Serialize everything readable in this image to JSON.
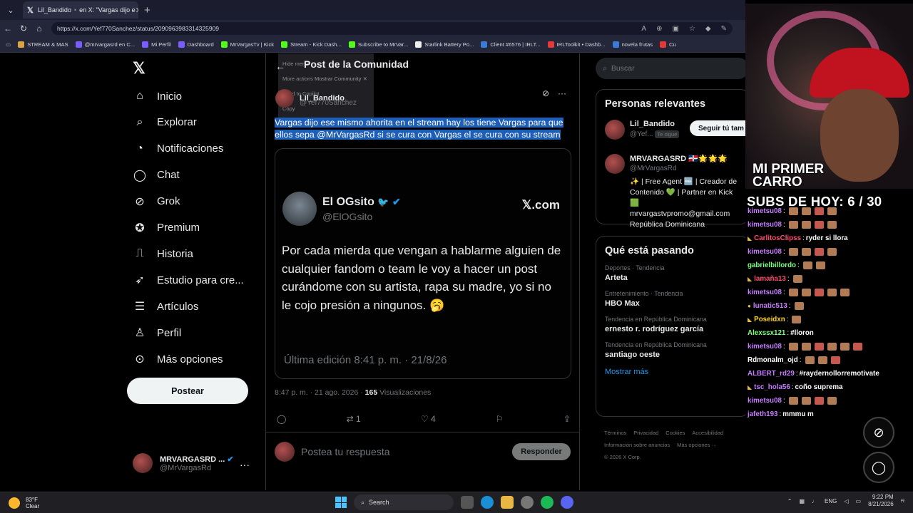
{
  "browser": {
    "tab_title": "Lil_Bandido",
    "tab_subtitle": "en X: \"Vargas dijo e",
    "url": "https://x.com/Yef770Sanchez/status/2090963983314325909",
    "bookmarks": [
      "STREAM & MAS",
      "@mrvargasrd en C...",
      "Mi Perfil",
      "Dashboard",
      "MrVargasTv | Kick",
      "Stream - Kick Dash...",
      "Subscribe to MrVar...",
      "Starlink Battery Po...",
      "Client #6576 | IRLT...",
      "IRLToolkit • Dashb...",
      "novela frutas",
      "Cu"
    ],
    "bookmark_colors": [
      "#d9a441",
      "#7b5cff",
      "#7b5cff",
      "#7b5cff",
      "#53fc18",
      "#53fc18",
      "#53fc18",
      "#eeeeee",
      "#3a7bd5",
      "#e53935",
      "#3a7bd5",
      "#e53935"
    ]
  },
  "nav": {
    "items": [
      {
        "label": "Inicio",
        "icon": "⌂",
        "name": "home"
      },
      {
        "label": "Explorar",
        "icon": "⌕",
        "name": "explore"
      },
      {
        "label": "Notificaciones",
        "icon": "◔",
        "name": "notifications"
      },
      {
        "label": "Chat",
        "icon": "◯",
        "name": "chat"
      },
      {
        "label": "Grok",
        "icon": "⊘",
        "name": "grok"
      },
      {
        "label": "Premium",
        "icon": "✪",
        "name": "premium"
      },
      {
        "label": "Historia",
        "icon": "⎍",
        "name": "history"
      },
      {
        "label": "Estudio para cre...",
        "icon": "➶",
        "name": "studio"
      },
      {
        "label": "Artículos",
        "icon": "☰",
        "name": "articles"
      },
      {
        "label": "Perfil",
        "icon": "♙",
        "name": "profile"
      },
      {
        "label": "Más opciones",
        "icon": "⊙",
        "name": "more"
      }
    ],
    "post_button": "Postear",
    "me_name": "MRVARGASRD ...",
    "me_handle": "@MrVargasRd"
  },
  "post": {
    "header": "Post de la Comunidad",
    "context_menu": [
      "Hide menu",
      "More actions",
      "Send to Copilot",
      "Copy",
      "Search"
    ],
    "context_menu_extra": "Mostrar Community",
    "author": "Lil_Bandido",
    "author_handle": "@Yef770Sanchez",
    "text_line1": "Vargas dijo ese mismo ahorita en el stream hay los tiene Vargas para que",
    "text_line2": "ellos sepa @MrVargasRd  si se cura con Vargas el se cura con su stream",
    "quoted": {
      "name": "El OGsito",
      "bird": "🐦",
      "handle": "@ElOGsito",
      "site": "𝕏.com",
      "text": "Por cada mierda que vengan a hablarme alguien de cualquier fandom o team le voy a hacer un post curándome con su artista, rapa su madre, yo si no le cojo presión a ningunos. 🥱",
      "edited": "Última edición 8:41 p. m. · 21/8/26"
    },
    "time": "8:47 p. m. · 21 ago. 2026 · ",
    "views_count": "165",
    "views_label": " Visualizaciones",
    "retweets": "1",
    "likes": "4",
    "reply_placeholder": "Postea tu respuesta",
    "reply_button": "Responder"
  },
  "sidebar": {
    "search_placeholder": "Buscar",
    "relevant_title": "Personas relevantes",
    "rel1_name": "Lil_Bandido",
    "rel1_handle": "@Yef...",
    "rel1_badge": "Te sigue",
    "rel1_button": "Seguir tú tam",
    "rel2_name": "MRVARGASRD 🇩🇴🌟🌟🌟",
    "rel2_handle": "@MrVargasRd",
    "rel2_bio": "✨ | Free Agent 🆓 | Creador de Contenido 💚 | Partner en Kick 🟩 mrvargastvpromo@gmail.com República Dominicana",
    "trends_title": "Qué está pasando",
    "trends": [
      {
        "cat": "Deportes · Tendencia",
        "name": "Arteta"
      },
      {
        "cat": "Entretenimiento · Tendencia",
        "name": "HBO Max"
      },
      {
        "cat": "Tendencia en República Dominicana",
        "name": "ernesto r. rodríguez garcía"
      },
      {
        "cat": "Tendencia en República Dominicana",
        "name": "santiago oeste"
      }
    ],
    "show_more": "Mostrar más",
    "footer_links": [
      "Términos",
      "Privacidad",
      "Cookies",
      "Accesibilidad"
    ],
    "footer_line2": [
      "Información sobre anuncios",
      "Más opciones ···"
    ],
    "copyright": "© 2026 X Corp."
  },
  "stream": {
    "car_title_1": "MI PRIMER",
    "car_title_2": "CARRO",
    "subs": "SUBS DE HOY: 6 / 30",
    "chat": [
      {
        "user": "kimetsu08",
        "color": "#c77dff",
        "badge": "",
        "msg": "",
        "emotes": 4
      },
      {
        "user": "kimetsu08",
        "color": "#c77dff",
        "badge": "",
        "msg": "",
        "emotes": 4
      },
      {
        "user": "CarlitosClipss",
        "color": "#ff4d6d",
        "badge": "◣",
        "msg": "ryder si llora",
        "emotes": 0
      },
      {
        "user": "kimetsu08",
        "color": "#c77dff",
        "badge": "",
        "msg": "",
        "emotes": 4
      },
      {
        "user": "gabrielbillordo",
        "color": "#7dff7d",
        "badge": "",
        "msg": "",
        "emotes": 2
      },
      {
        "user": "lamaña13",
        "color": "#ff4d6d",
        "badge": "◣",
        "msg": "",
        "emotes": 1
      },
      {
        "user": "kimetsu08",
        "color": "#c77dff",
        "badge": "",
        "msg": "",
        "emotes": 5
      },
      {
        "user": "lunatic513",
        "color": "#c77dff",
        "badge": "●",
        "msg": "",
        "emotes": 1
      },
      {
        "user": "Poseidxn",
        "color": "#ffd60a",
        "badge": "◣",
        "msg": "",
        "emotes": 1
      },
      {
        "user": "Alexssx121",
        "color": "#7dff7d",
        "badge": "",
        "msg": "#lloron",
        "emotes": 0
      },
      {
        "user": "kimetsu08",
        "color": "#c77dff",
        "badge": "",
        "msg": "",
        "emotes": 6
      },
      {
        "user": "Rdmonalm_ojd",
        "color": "#ffffff",
        "badge": "",
        "msg": "",
        "emotes": 3
      },
      {
        "user": "ALBERT_rd29",
        "color": "#c77dff",
        "badge": "",
        "msg": "#raydernollorremotivate",
        "emotes": 0
      },
      {
        "user": "tsc_hola56",
        "color": "#c77dff",
        "badge": "◣",
        "msg": "coño suprema",
        "emotes": 0
      },
      {
        "user": "kimetsu08",
        "color": "#c77dff",
        "badge": "",
        "msg": "",
        "emotes": 4
      },
      {
        "user": "jafeth193",
        "color": "#c77dff",
        "badge": "",
        "msg": "mmmu m",
        "emotes": 0
      }
    ]
  },
  "taskbar": {
    "temp": "83°F",
    "weather": "Clear",
    "search": "Search",
    "lang": "ENG",
    "time": "9:22 PM",
    "date": "8/21/2026"
  }
}
